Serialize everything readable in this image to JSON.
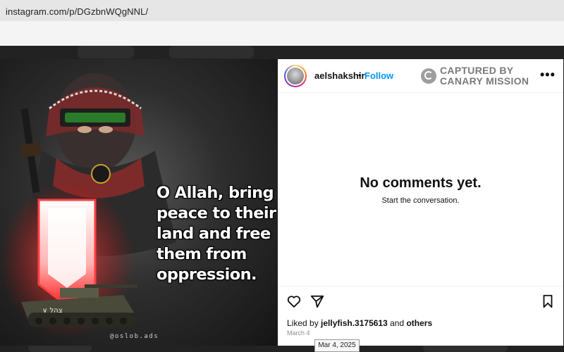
{
  "browser": {
    "url": "instagram.com/p/DGzbnWQgNNL/"
  },
  "post": {
    "caption": "O Allah, bring peace to their land and free them from oppression.",
    "watermark": "@oslob.ads",
    "tank_marking": "∨ צהל"
  },
  "header": {
    "username": "aelshakshir",
    "separator": "•",
    "follow_label": "Follow",
    "stamp_line1": "CAPTURED BY",
    "stamp_line2": "CANARY MISSION",
    "more_label": "•••"
  },
  "comments": {
    "empty_title": "No comments yet.",
    "empty_subtitle": "Start the conversation."
  },
  "footer": {
    "liked_prefix": "Liked by ",
    "liked_user": "jellyfish.3175613",
    "liked_middle": " and ",
    "liked_others": "others",
    "date": "March 4",
    "tooltip": "Mar 4, 2025"
  },
  "icons": {
    "like": "heart-outline-icon",
    "share": "paper-plane-icon",
    "save": "bookmark-icon",
    "more": "ellipsis-icon",
    "stamp": "canary-mission-logo"
  }
}
